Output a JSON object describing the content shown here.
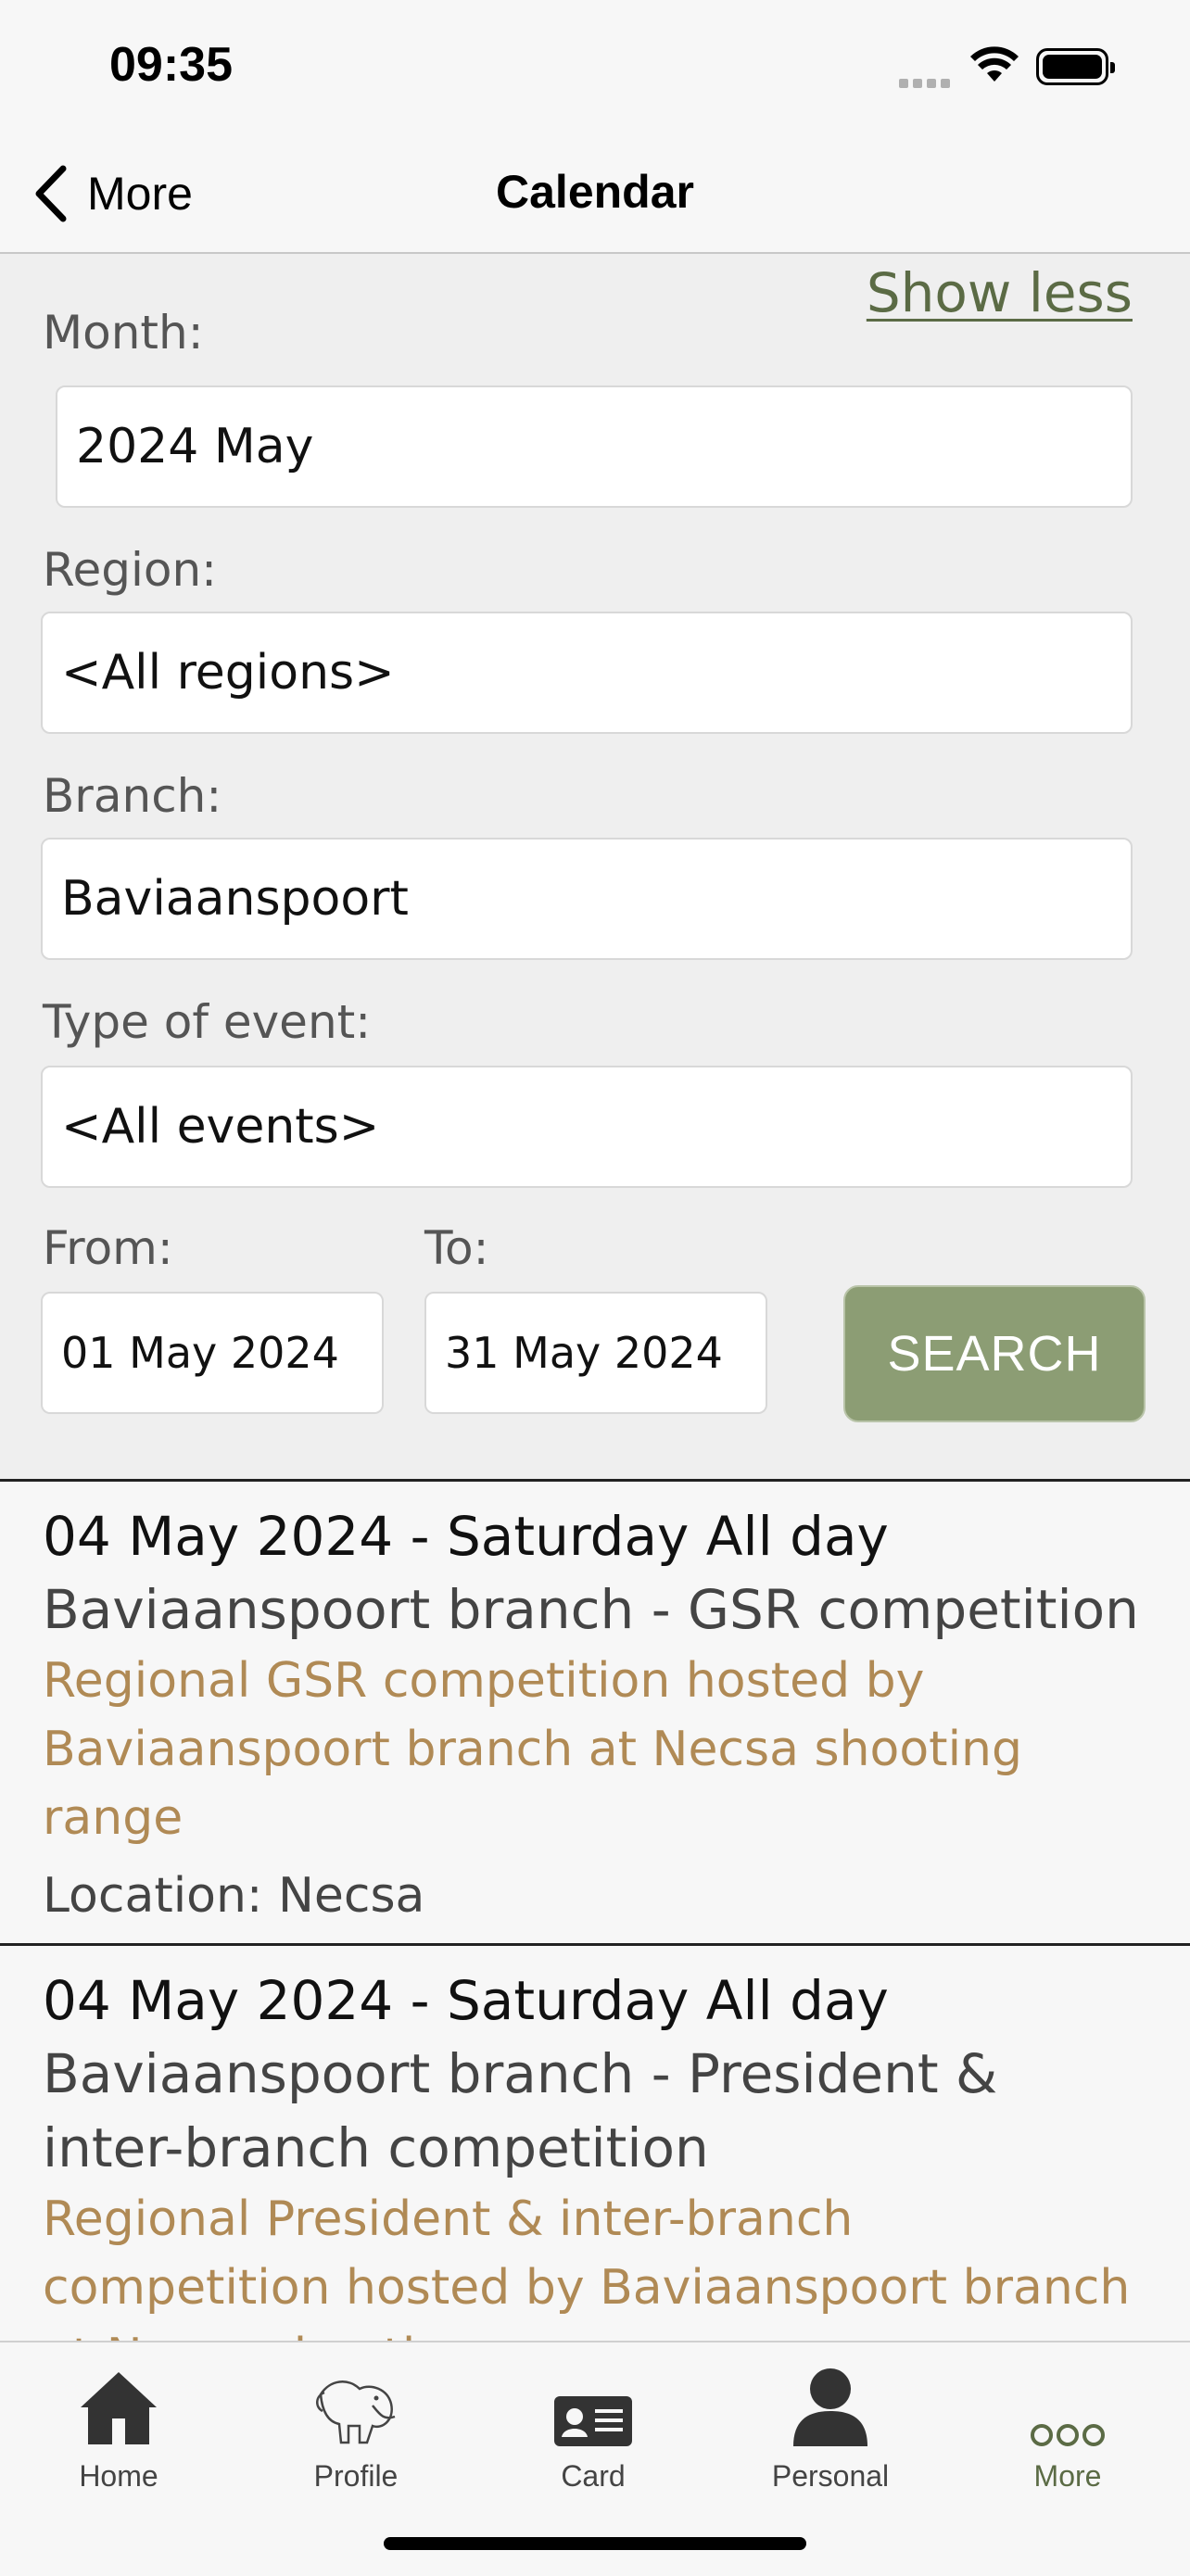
{
  "status": {
    "time": "09:35"
  },
  "nav": {
    "back_label": "More",
    "title": "Calendar"
  },
  "filters": {
    "show_less": "Show less",
    "month_label": "Month:",
    "month_value": "2024 May",
    "region_label": "Region:",
    "region_value": "<All regions>",
    "branch_label": "Branch:",
    "branch_value": "Baviaanspoort",
    "type_label": "Type of event:",
    "type_value": "<All events>",
    "from_label": "From:",
    "from_value": "01 May 2024",
    "to_label": "To:",
    "to_value": "31 May 2024",
    "search_label": "SEARCH"
  },
  "events": [
    {
      "date": "04 May 2024 - Saturday All day",
      "title": "Baviaanspoort branch - GSR competition",
      "description": "Regional GSR competition hosted by Baviaanspoort branch at Necsa shooting range",
      "location": "Location: Necsa"
    },
    {
      "date": "04 May 2024 - Saturday All day",
      "title": "Baviaanspoort branch - President & inter-branch competition",
      "description": "Regional President & inter-branch competition hosted by Baviaanspoort branch at Necsa shooting range"
    }
  ],
  "tabs": [
    {
      "label": "Home",
      "icon": "home-icon"
    },
    {
      "label": "Profile",
      "icon": "profile-icon"
    },
    {
      "label": "Card",
      "icon": "card-icon"
    },
    {
      "label": "Personal",
      "icon": "person-icon"
    },
    {
      "label": "More",
      "icon": "more-icon",
      "active": true
    }
  ],
  "colors": {
    "accent": "#5b6b45",
    "search_button": "#8c9d74",
    "event_description": "#b08a55"
  }
}
